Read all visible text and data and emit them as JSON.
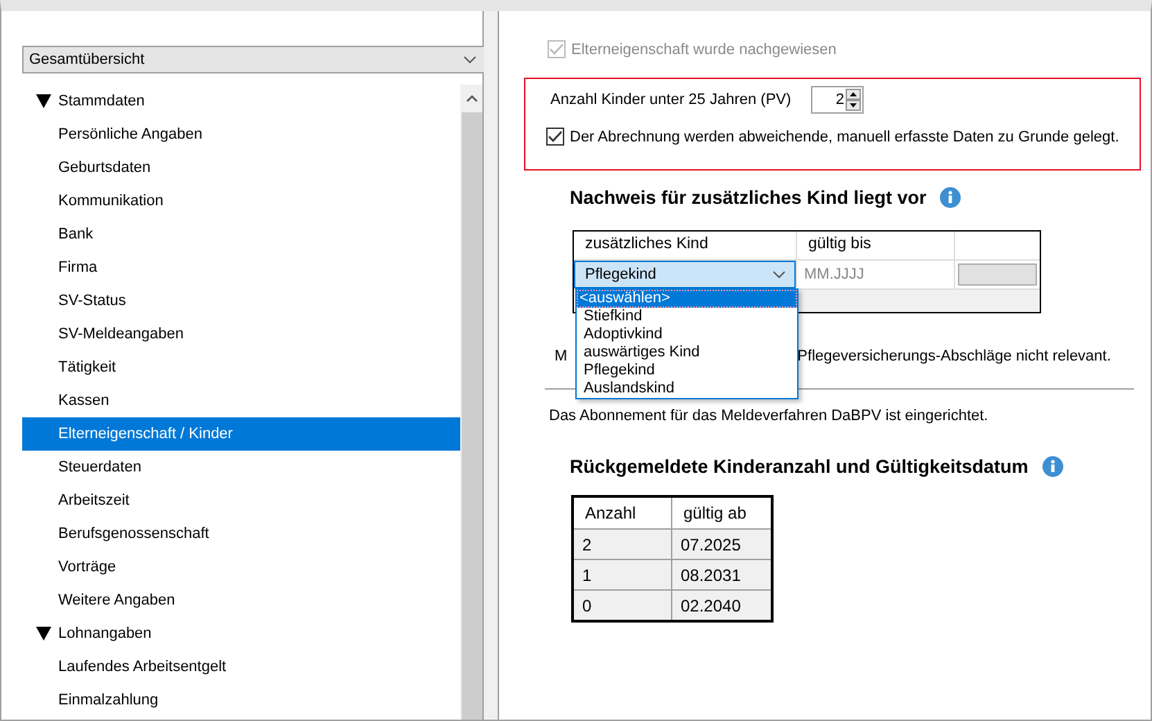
{
  "sidebar": {
    "view_select": "Gesamtübersicht",
    "tree": [
      {
        "label": "Stammdaten",
        "expanded": true,
        "selected": false,
        "children": [
          {
            "label": "Persönliche Angaben",
            "selected": false
          },
          {
            "label": "Geburtsdaten",
            "selected": false
          },
          {
            "label": "Kommunikation",
            "selected": false
          },
          {
            "label": "Bank",
            "selected": false
          },
          {
            "label": "Firma",
            "selected": false
          },
          {
            "label": "SV-Status",
            "selected": false
          },
          {
            "label": "SV-Meldeangaben",
            "selected": false
          },
          {
            "label": "Tätigkeit",
            "selected": false
          },
          {
            "label": "Kassen",
            "selected": false
          },
          {
            "label": "Elterneigenschaft / Kinder",
            "selected": true
          },
          {
            "label": "Steuerdaten",
            "selected": false
          },
          {
            "label": "Arbeitszeit",
            "selected": false
          },
          {
            "label": "Berufsgenossenschaft",
            "selected": false
          },
          {
            "label": "Vorträge",
            "selected": false
          },
          {
            "label": "Weitere Angaben",
            "selected": false
          }
        ]
      },
      {
        "label": "Lohnangaben",
        "expanded": true,
        "selected": false,
        "children": [
          {
            "label": "Laufendes Arbeitsentgelt",
            "selected": false
          },
          {
            "label": "Einmalzahlung",
            "selected": false
          }
        ]
      }
    ]
  },
  "main": {
    "parent_checkbox": {
      "label": "Elterneigenschaft wurde nachgewiesen",
      "checked": true,
      "disabled": true
    },
    "children_count": {
      "label": "Anzahl Kinder unter 25 Jahren (PV)",
      "value": "2"
    },
    "manual_checkbox": {
      "label": "Der Abrechnung werden abweichende, manuell erfasste Daten zu Grunde gelegt.",
      "checked": true,
      "disabled": false
    },
    "proof_section": {
      "heading": "Nachweis für zusätzliches Kind liegt vor",
      "columns": [
        "zusätzliches Kind",
        "gültig bis"
      ],
      "row": {
        "kind": "Pflegekind",
        "valid_until_placeholder": "MM.JJJJ"
      },
      "dropdown_options": [
        {
          "label": "<auswählen>",
          "selected": true
        },
        {
          "label": "Stiefkind",
          "selected": false
        },
        {
          "label": "Adoptivkind",
          "selected": false
        },
        {
          "label": "auswärtiges Kind",
          "selected": false
        },
        {
          "label": "Pflegekind",
          "selected": false
        },
        {
          "label": "Auslandskind",
          "selected": false
        }
      ],
      "note_start": "M",
      "note_end": "Pflegeversicherungs-Abschläge nicht relevant."
    },
    "subscription_text": "Das Abonnement für das Meldeverfahren DaBPV ist eingerichtet.",
    "reported_section": {
      "heading": "Rückgemeldete Kinderanzahl und Gültigkeitsdatum",
      "columns": [
        "Anzahl",
        "gültig ab"
      ],
      "rows": [
        [
          "2",
          "07.2025"
        ],
        [
          "1",
          "08.2031"
        ],
        [
          "0",
          "02.2040"
        ]
      ]
    }
  }
}
